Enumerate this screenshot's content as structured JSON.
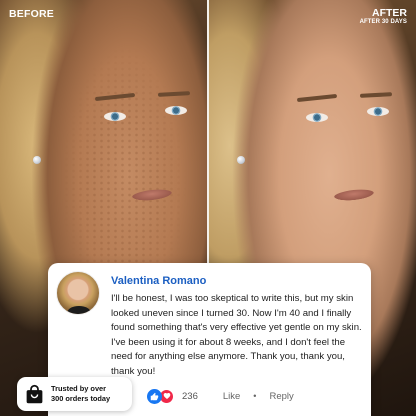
{
  "before_label": "BEFORE",
  "after_label": "AFTER",
  "after_sublabel": "AFTER 30 DAYS",
  "review": {
    "author": "Valentina Romano",
    "text": "I'll be honest, I was too skeptical to write this, but my skin looked uneven since I turned 30. Now I'm 40 and I finally found something that's very effective yet gentle on my skin. I've been using it for about 8 weeks, and I don't feel the need for anything else anymore. Thank you, thank you, thank you!",
    "reaction_count": "236",
    "like_label": "Like",
    "separator": "•",
    "reply_label": "Reply"
  },
  "trust_badge": {
    "line1": "Trusted by over",
    "line2": "300 orders today"
  },
  "colors": {
    "author_blue": "#1c5fc2",
    "like_blue": "#1877f2",
    "love_red": "#f02849"
  },
  "icons": {
    "like": "thumbs-up-icon",
    "love": "heart-icon",
    "bag": "shopping-bag-icon"
  }
}
